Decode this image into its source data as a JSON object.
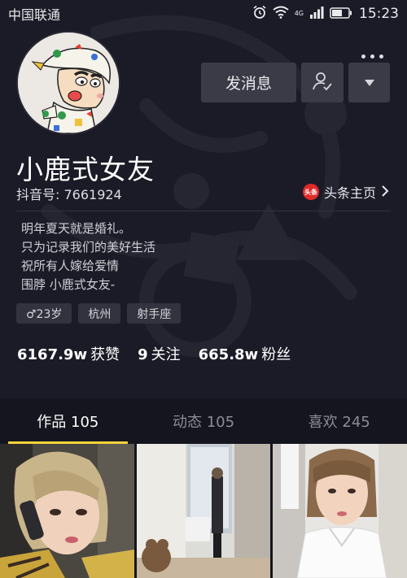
{
  "status_bar": {
    "carrier": "中国联通",
    "network": "4G",
    "time": "15:23"
  },
  "profile": {
    "name": "小鹿式女友",
    "uid_label": "抖音号: 7661924",
    "toutiao_badge": "头条",
    "toutiao_label": "头条主页",
    "bio": [
      "明年夏天就是婚礼。",
      "只为记录我们的美好生活",
      "祝所有人嫁给爱情",
      "围脖 小鹿式女友-"
    ],
    "tags": [
      "♂23岁",
      "杭州",
      "射手座"
    ]
  },
  "actions": {
    "message_label": "发消息"
  },
  "stats": [
    {
      "value": "6167.9w",
      "label": "获赞"
    },
    {
      "value": "9",
      "label": "关注"
    },
    {
      "value": "665.8w",
      "label": "粉丝"
    }
  ],
  "tabs": [
    {
      "label": "作品 105",
      "active": true
    },
    {
      "label": "动态 105",
      "active": false
    },
    {
      "label": "喜欢 245",
      "active": false
    }
  ],
  "colors": {
    "accent": "#f3d33b",
    "background": "#15151f",
    "button": "#3b3b48"
  }
}
